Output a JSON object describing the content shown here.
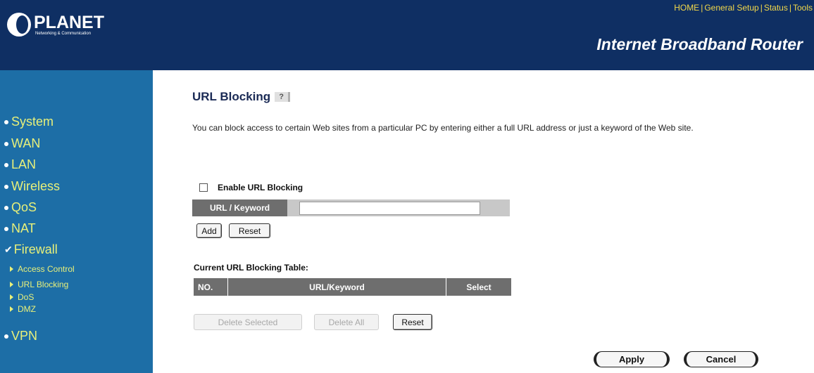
{
  "header": {
    "logo_name": "PLANET",
    "logo_tagline": "Networking & Communication",
    "nav": [
      "HOME",
      "General Setup",
      "Status",
      "Tools"
    ],
    "product_title": "Internet Broadband Router"
  },
  "sidebar": {
    "items": [
      {
        "label": "System",
        "marker": "bullet"
      },
      {
        "label": "WAN",
        "marker": "bullet"
      },
      {
        "label": "LAN",
        "marker": "bullet"
      },
      {
        "label": "Wireless",
        "marker": "bullet"
      },
      {
        "label": "QoS",
        "marker": "bullet"
      },
      {
        "label": "NAT",
        "marker": "bullet"
      },
      {
        "label": "Firewall",
        "marker": "check"
      },
      {
        "label": "VPN",
        "marker": "bullet"
      }
    ],
    "firewall_sub": [
      "Access Control",
      "URL Blocking",
      "DoS",
      "DMZ"
    ]
  },
  "main": {
    "title": "URL Blocking",
    "help_icon": "help-icon",
    "description": "You can block access to certain Web sites from a particular PC by entering either a full URL address or just a keyword of the Web site.",
    "enable_label": "Enable URL Blocking",
    "enable_checked": false,
    "url_keyword_label": "URL / Keyword",
    "url_keyword_value": "",
    "add_label": "Add",
    "reset_label": "Reset",
    "table_title": "Current URL Blocking Table:",
    "table_headers": [
      "NO.",
      "URL/Keyword",
      "Select"
    ],
    "table_rows": [],
    "delete_selected_label": "Delete Selected",
    "delete_all_label": "Delete All",
    "reset2_label": "Reset",
    "apply_label": "Apply",
    "cancel_label": "Cancel"
  },
  "colors": {
    "header_bg": "#0f2f63",
    "sidebar_bg": "#1d6ea6",
    "nav_text": "#f2d84a",
    "sidebar_text": "#e8f07a"
  }
}
